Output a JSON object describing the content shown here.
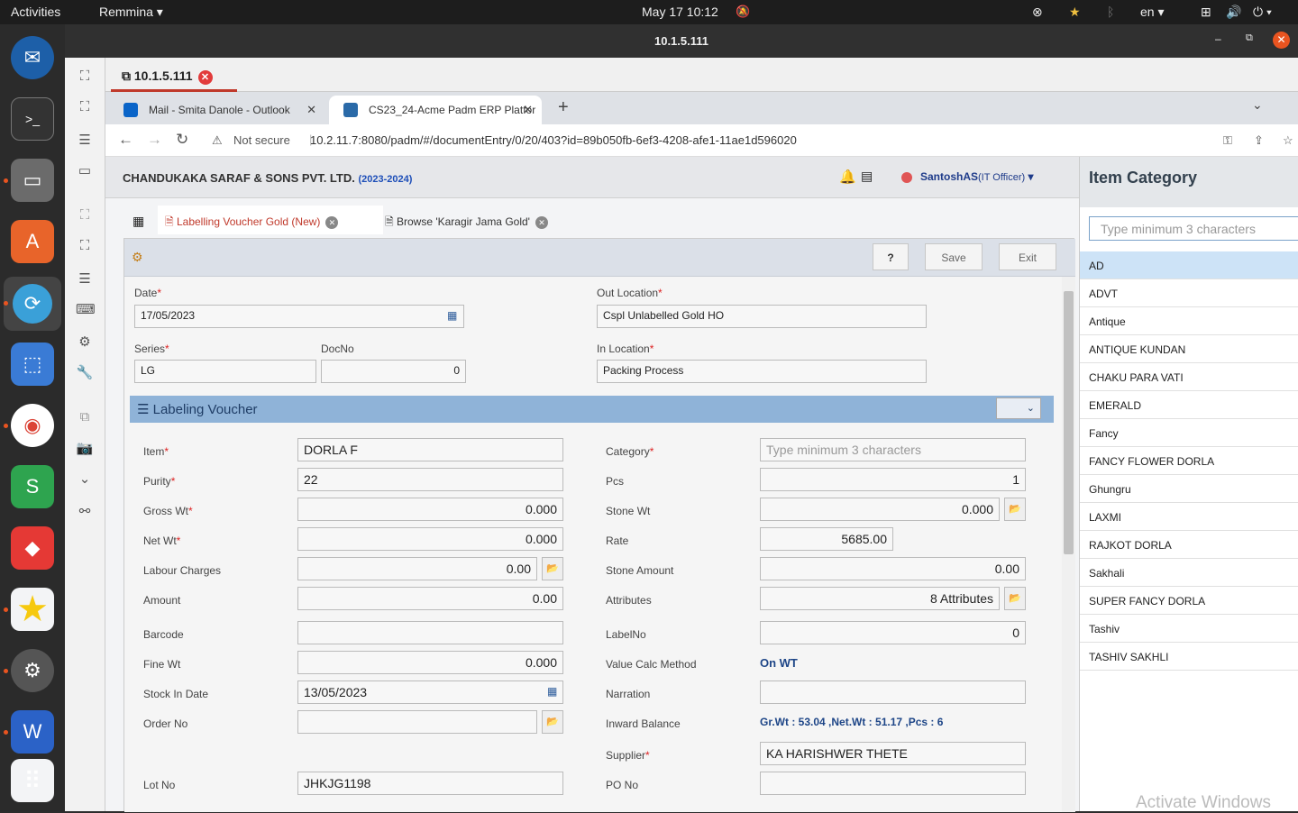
{
  "system": {
    "activities": "Activities",
    "app_menu": "Remmina ▾",
    "clock": "May 17  10:12",
    "lang": "en ▾"
  },
  "remmina": {
    "title": "10.1.5.111",
    "tab": "10.1.5.111"
  },
  "browser": {
    "tabs": [
      {
        "label": "Mail - Smita Danole - Outlook"
      },
      {
        "label": "CS23_24-Acme Padm ERP Platfor"
      }
    ],
    "not_secure": "Not secure",
    "url": "10.2.11.7:8080/padm/#/documentEntry/0/20/403?id=89b050fb-6ef3-4208-afe1-11ae1d596020"
  },
  "app": {
    "company": "CHANDUKAKA SARAF & SONS PVT. LTD.",
    "year": "(2023-2024)",
    "user": "SantoshAS",
    "user_role": "(IT Officer)",
    "tabs": [
      {
        "label": "Labelling Voucher Gold (New)"
      },
      {
        "label": "Browse 'Karagir Jama Gold'"
      }
    ],
    "save": "Save",
    "exit": "Exit",
    "top": {
      "date_label": "Date",
      "date": "17/05/2023",
      "out_location_label": "Out Location",
      "out_location": "Cspl Unlabelled Gold HO",
      "series_label": "Series",
      "series": "LG",
      "docno_label": "DocNo",
      "docno": "0",
      "in_location_label": "In Location",
      "in_location": "Packing Process"
    },
    "section_title": "Labeling Voucher",
    "left": {
      "item_label": "Item",
      "item": "DORLA F",
      "purity_label": "Purity",
      "purity": "22",
      "gross_label": "Gross Wt",
      "gross": "0.000",
      "net_label": "Net Wt",
      "net": "0.000",
      "labour_label": "Labour Charges",
      "labour": "0.00",
      "amount_label": "Amount",
      "amount": "0.00",
      "barcode_label": "Barcode",
      "barcode": "",
      "fine_label": "Fine Wt",
      "fine": "0.000",
      "stock_label": "Stock In Date",
      "stock": "13/05/2023",
      "order_label": "Order No",
      "order": "",
      "lot_label": "Lot No",
      "lot": "JHKJG1198"
    },
    "right": {
      "category_label": "Category",
      "category_placeholder": "Type minimum 3 characters",
      "pcs_label": "Pcs",
      "pcs": "1",
      "stone_wt_label": "Stone Wt",
      "stone_wt": "0.000",
      "rate_label": "Rate",
      "rate": "5685.00",
      "stone_amt_label": "Stone Amount",
      "stone_amt": "0.00",
      "attr_label": "Attributes",
      "attr": "8 Attributes",
      "labelno_label": "LabelNo",
      "labelno": "0",
      "vcm_label": "Value Calc Method",
      "vcm": "On WT",
      "narration_label": "Narration",
      "narration": "",
      "inward_label": "Inward Balance",
      "inward": "Gr.Wt : 53.04 ,Net.Wt : 51.17 ,Pcs : 6",
      "supplier_label": "Supplier",
      "supplier": "KA HARISHWER THETE",
      "po_label": "PO No",
      "po": ""
    }
  },
  "sidepanel": {
    "title": "Item Category",
    "search_placeholder": "Type minimum 3 characters",
    "items": [
      "AD",
      "ADVT",
      "Antique",
      "ANTIQUE KUNDAN",
      "CHAKU PARA VATI",
      "EMERALD",
      "Fancy",
      "FANCY FLOWER DORLA",
      "Ghungru",
      "LAXMI",
      "RAJKOT DORLA",
      "Sakhali",
      "SUPER FANCY DORLA",
      "Tashiv",
      "TASHIV SAKHLI"
    ]
  },
  "watermark": "Activate Windows"
}
